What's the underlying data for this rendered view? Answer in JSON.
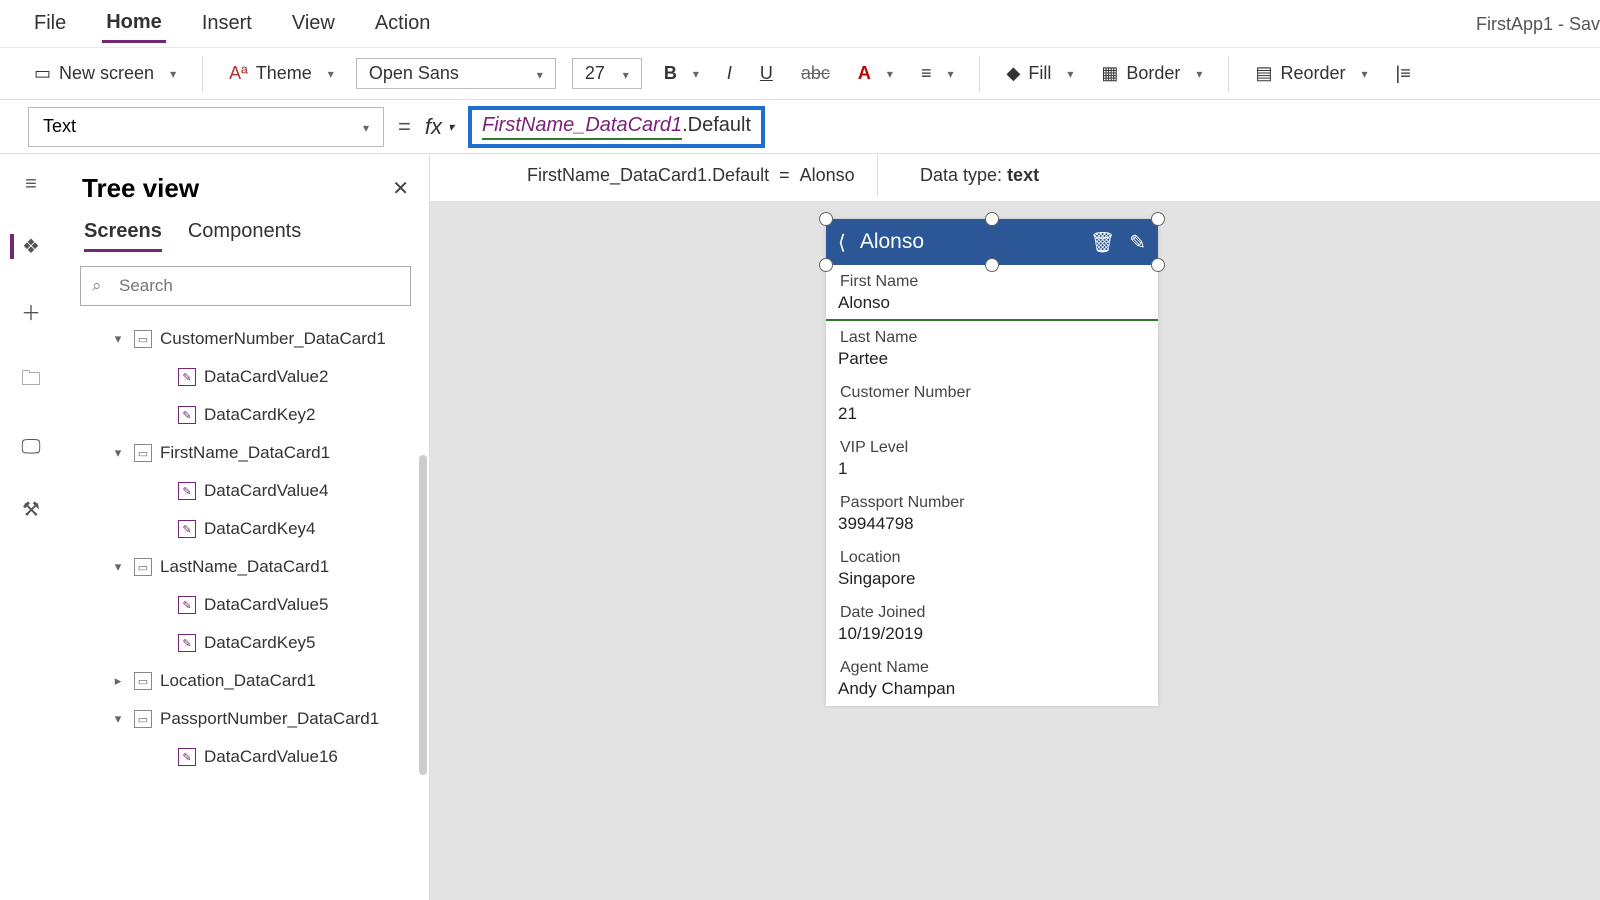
{
  "app_title": "FirstApp1 - Sav",
  "menu": {
    "file": "File",
    "home": "Home",
    "insert": "Insert",
    "view": "View",
    "action": "Action"
  },
  "ribbon": {
    "new_screen": "New screen",
    "theme": "Theme",
    "font": "Open Sans",
    "font_size": "27",
    "fill": "Fill",
    "border": "Border",
    "reorder": "Reorder"
  },
  "property": {
    "name": "Text",
    "formula_token1": "FirstName_DataCard1",
    "formula_token2": ".Default"
  },
  "eval": {
    "lhs": "FirstName_DataCard1.Default",
    "eq": "=",
    "rhs": "Alonso",
    "datatype_label": "Data type:",
    "datatype": "text"
  },
  "panel": {
    "title": "Tree view",
    "tab_screens": "Screens",
    "tab_components": "Components",
    "search_placeholder": "Search"
  },
  "tree": [
    {
      "label": "CustomerNumber_DataCard1",
      "depth": 1,
      "expand": "down",
      "icon": "card"
    },
    {
      "label": "DataCardValue2",
      "depth": 2,
      "expand": "",
      "icon": "edit"
    },
    {
      "label": "DataCardKey2",
      "depth": 2,
      "expand": "",
      "icon": "edit"
    },
    {
      "label": "FirstName_DataCard1",
      "depth": 1,
      "expand": "down",
      "icon": "card"
    },
    {
      "label": "DataCardValue4",
      "depth": 2,
      "expand": "",
      "icon": "edit"
    },
    {
      "label": "DataCardKey4",
      "depth": 2,
      "expand": "",
      "icon": "edit"
    },
    {
      "label": "LastName_DataCard1",
      "depth": 1,
      "expand": "down",
      "icon": "card"
    },
    {
      "label": "DataCardValue5",
      "depth": 2,
      "expand": "",
      "icon": "edit"
    },
    {
      "label": "DataCardKey5",
      "depth": 2,
      "expand": "",
      "icon": "edit"
    },
    {
      "label": "Location_DataCard1",
      "depth": 1,
      "expand": "right",
      "icon": "card"
    },
    {
      "label": "PassportNumber_DataCard1",
      "depth": 1,
      "expand": "down",
      "icon": "card"
    },
    {
      "label": "DataCardValue16",
      "depth": 2,
      "expand": "",
      "icon": "edit"
    }
  ],
  "form": {
    "title": "Alonso",
    "fields": [
      {
        "label": "First Name",
        "value": "Alonso"
      },
      {
        "label": "Last Name",
        "value": "Partee"
      },
      {
        "label": "Customer Number",
        "value": "21"
      },
      {
        "label": "VIP Level",
        "value": "1"
      },
      {
        "label": "Passport Number",
        "value": "39944798"
      },
      {
        "label": "Location",
        "value": "Singapore"
      },
      {
        "label": "Date Joined",
        "value": "10/19/2019"
      },
      {
        "label": "Agent Name",
        "value": "Andy Champan"
      }
    ]
  }
}
